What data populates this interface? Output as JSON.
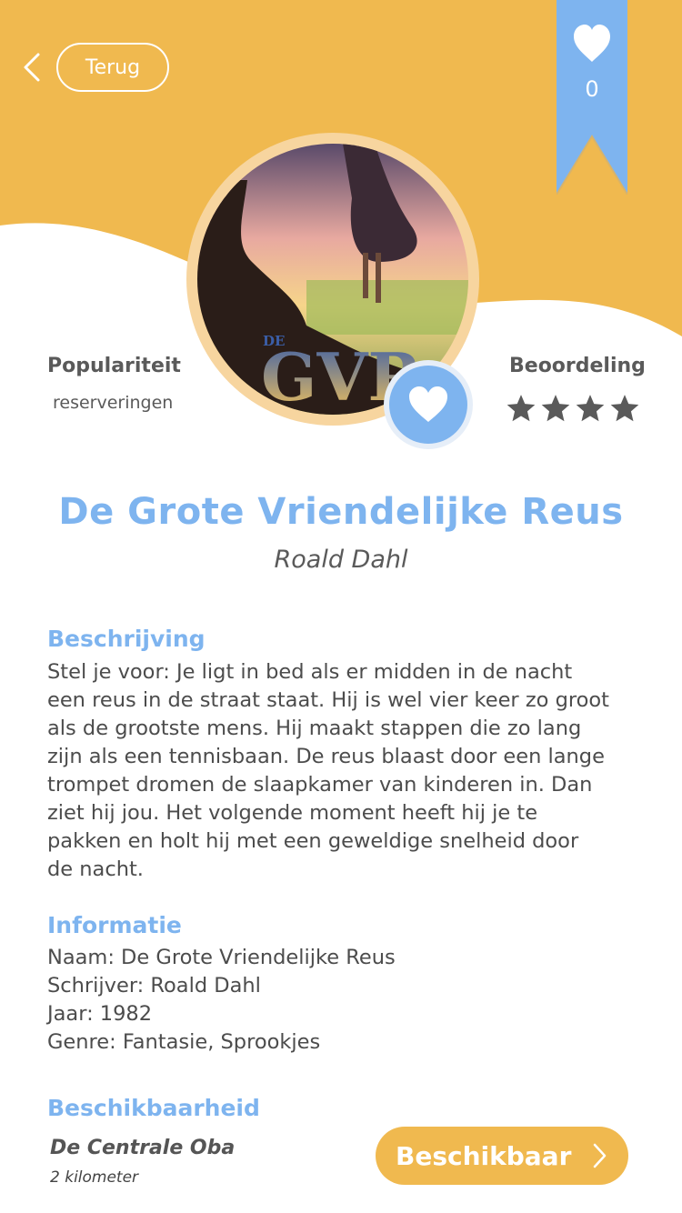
{
  "colors": {
    "accent_orange": "#f0b94f",
    "accent_blue": "#7eb4ef",
    "text_gray": "#5a5a5a"
  },
  "header": {
    "back_label": "Terug",
    "favorites_count": "0"
  },
  "cover": {
    "logo_text": "GVR",
    "logo_small": "DE"
  },
  "stats": {
    "popularity_title": "Populariteit",
    "popularity_sub": "reserveringen",
    "rating_title": "Beoordeling",
    "rating_stars": 4
  },
  "book": {
    "title": "De Grote Vriendelijke Reus",
    "author": "Roald Dahl"
  },
  "description": {
    "heading": "Beschrijving",
    "lines": [
      "Stel je voor: Je ligt in bed als er midden in de nacht",
      "een reus in  de straat staat. Hij is wel vier keer zo groot",
      "als de grootste mens. Hij maakt stappen die zo lang",
      "zijn als een tennisbaan. De reus blaast door een lange",
      "trompet dromen de slaapkamer van kinderen in. Dan",
      "ziet hij jou. Het volgende moment heeft hij je te",
      "pakken en holt hij met een geweldige snelheid door",
      "de nacht."
    ]
  },
  "information": {
    "heading": "Informatie",
    "name": "Naam: De Grote Vriendelijke Reus",
    "writer": "Schrijver: Roald Dahl",
    "year": "Jaar: 1982",
    "genre": "Genre: Fantasie, Sprookjes"
  },
  "availability": {
    "heading": "Beschikbaarheid",
    "library": "De Centrale Oba",
    "distance": "2 kilometer",
    "button_label": "Beschikbaar"
  }
}
